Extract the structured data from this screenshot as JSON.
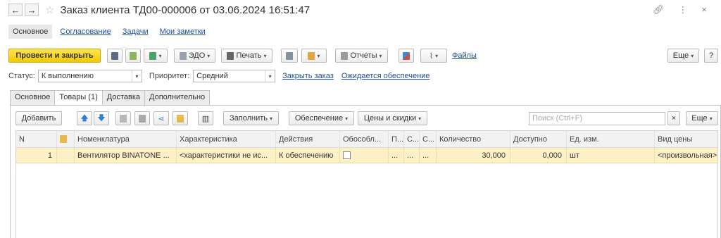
{
  "title": "Заказ клиента ТД00-000006 от 03.06.2024 16:51:47",
  "nav": {
    "back": "←",
    "forward": "→"
  },
  "page_tabs": [
    "Основное",
    "Согласование",
    "Задачи",
    "Мои заметки"
  ],
  "toolbar": {
    "post_close": "Провести и закрыть",
    "edo": "ЭДО",
    "print": "Печать",
    "reports": "Отчеты",
    "files": "Файлы",
    "more": "Еще",
    "help": "?"
  },
  "status_row": {
    "status_label": "Статус:",
    "status_value": "К выполнению",
    "priority_label": "Приоритет:",
    "priority_value": "Средний",
    "close_order": "Закрыть заказ",
    "awaiting": "Ожидается обеспечение"
  },
  "tabs": [
    "Основное",
    "Товары (1)",
    "Доставка",
    "Дополнительно"
  ],
  "tab_toolbar": {
    "add": "Добавить",
    "fill": "Заполнить",
    "supply": "Обеспечение",
    "prices": "Цены и скидки",
    "search_placeholder": "Поиск (Ctrl+F)",
    "clear": "×",
    "more": "Еще"
  },
  "grid": {
    "columns": [
      "N",
      "",
      "Номенклатура",
      "Характеристика",
      "Действия",
      "Обособл...",
      "П...",
      "С...",
      "С...",
      "Количество",
      "Доступно",
      "Ед. изм.",
      "Вид цены"
    ],
    "rows": [
      {
        "n": "1",
        "item": "Вентилятор BINATONE ...",
        "char": "<характеристики не ис...",
        "action": "К обеспечению",
        "p": "...",
        "s1": "...",
        "s2": "...",
        "qty": "30,000",
        "avail": "0,000",
        "unit": "шт",
        "price_type": "<произвольная>"
      }
    ]
  },
  "colors": {
    "accent_yellow": "#f3c900",
    "row_highlight": "#fcf0c6",
    "link": "#1a4e9c"
  }
}
